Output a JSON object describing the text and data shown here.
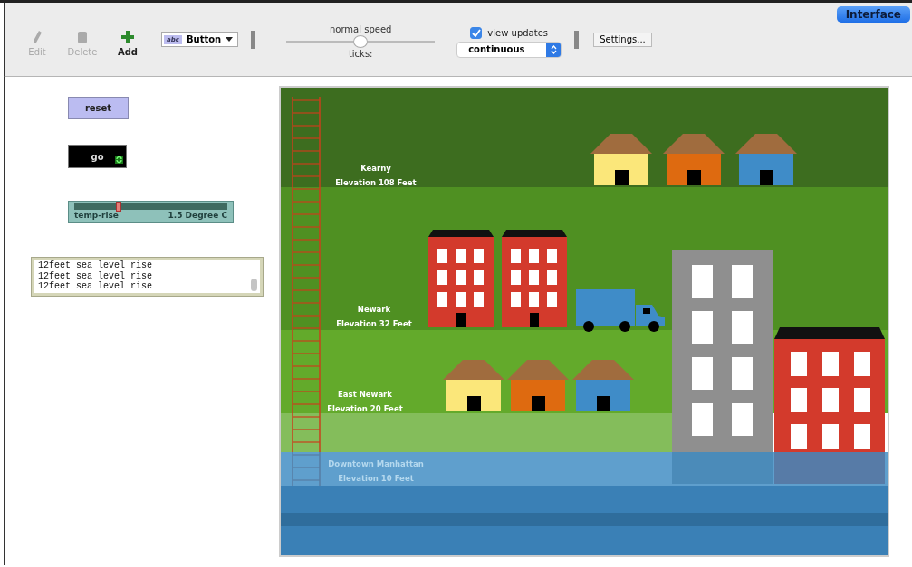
{
  "tab": {
    "label": "Interface",
    "selected": true
  },
  "toolbar": {
    "tools": [
      {
        "label": "Edit",
        "kind": "edit",
        "disabled": true
      },
      {
        "label": "Delete",
        "kind": "delete",
        "disabled": true
      },
      {
        "label": "Add",
        "kind": "add",
        "disabled": false
      }
    ],
    "widget_chooser": {
      "label": "Button",
      "icon_text": "abc"
    },
    "speed": {
      "label": "normal speed",
      "level": 0.5,
      "ticks_label": "ticks:"
    },
    "view_updates": {
      "label": "view updates",
      "checked": true
    },
    "update_mode": {
      "value": "continuous"
    },
    "settings_button": {
      "label": "Settings..."
    }
  },
  "widgets": {
    "reset_button": {
      "label": "reset"
    },
    "go_button": {
      "label": "go",
      "forever": true
    },
    "slider": {
      "name": "temp-rise",
      "reading": "1.5 Degree C",
      "level": 0.29
    },
    "output": {
      "lines": [
        "12feet sea level rise",
        "12feet sea level rise",
        "12feet sea level rise"
      ]
    }
  },
  "view": {
    "zones": [
      {
        "name": "Kearny",
        "elevation": "Elevation 108 Feet",
        "flooded": false
      },
      {
        "name": "Newark",
        "elevation": "Elevation 32 Feet",
        "flooded": false
      },
      {
        "name": "East Newark",
        "elevation": "Elevation 20 Feet",
        "flooded": false
      },
      {
        "name": "Downtown Manhattan",
        "elevation": "Elevation 10 Feet",
        "flooded": true
      }
    ]
  }
}
